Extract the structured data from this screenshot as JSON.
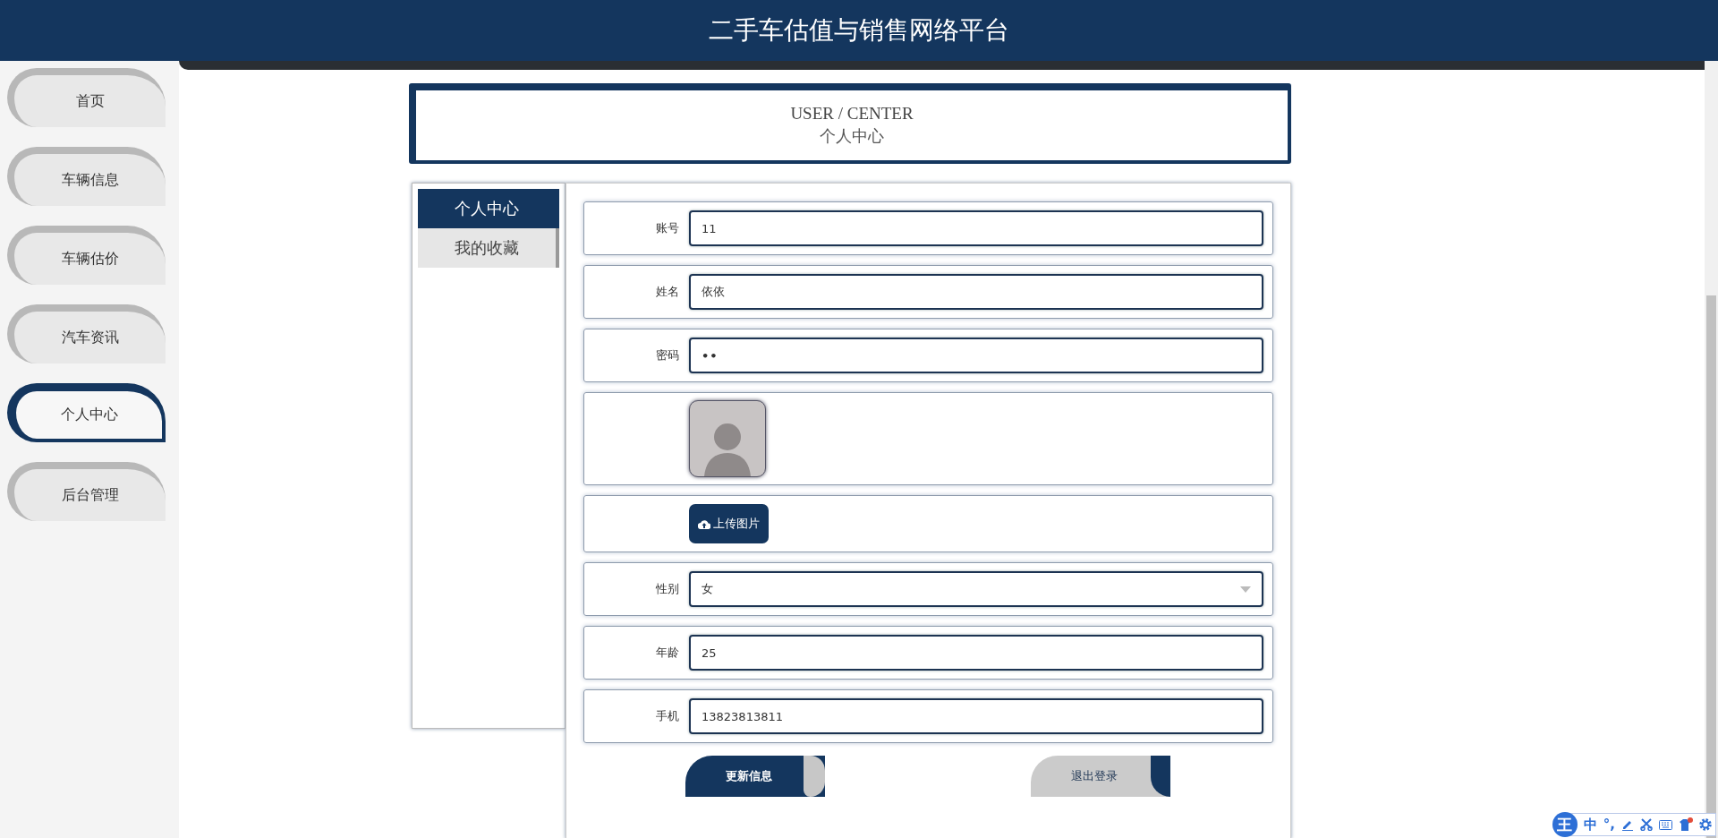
{
  "header": {
    "title": "二手车估值与销售网络平台"
  },
  "sidebar": {
    "items": [
      {
        "label": "首页",
        "selected": false
      },
      {
        "label": "车辆信息",
        "selected": false
      },
      {
        "label": "车辆估价",
        "selected": false
      },
      {
        "label": "汽车资讯",
        "selected": false
      },
      {
        "label": "个人中心",
        "selected": true
      },
      {
        "label": "后台管理",
        "selected": false
      }
    ]
  },
  "page_heading": {
    "english": "USER / CENTER",
    "chinese": "个人中心"
  },
  "tabs": [
    {
      "label": "个人中心",
      "selected": true
    },
    {
      "label": "我的收藏",
      "selected": false
    }
  ],
  "fields": [
    {
      "kind": "text",
      "label": "账号",
      "value": "11"
    },
    {
      "kind": "text",
      "label": "姓名",
      "value": "依依"
    },
    {
      "kind": "password",
      "label": "密码",
      "value": "••"
    },
    {
      "kind": "image"
    },
    {
      "kind": "upload",
      "button": "上传图片"
    },
    {
      "kind": "select",
      "label": "性别",
      "value": "女"
    },
    {
      "kind": "text",
      "label": "年龄",
      "value": "25"
    },
    {
      "kind": "text",
      "label": "手机",
      "value": "13823813811"
    }
  ],
  "buttons": [
    {
      "kind": "primary",
      "label": "更新信息"
    },
    {
      "kind": "secondary",
      "label": "退出登录"
    }
  ],
  "ime_toolbar": {
    "logo": "王",
    "mode": "中",
    "punctuation": "°,"
  }
}
